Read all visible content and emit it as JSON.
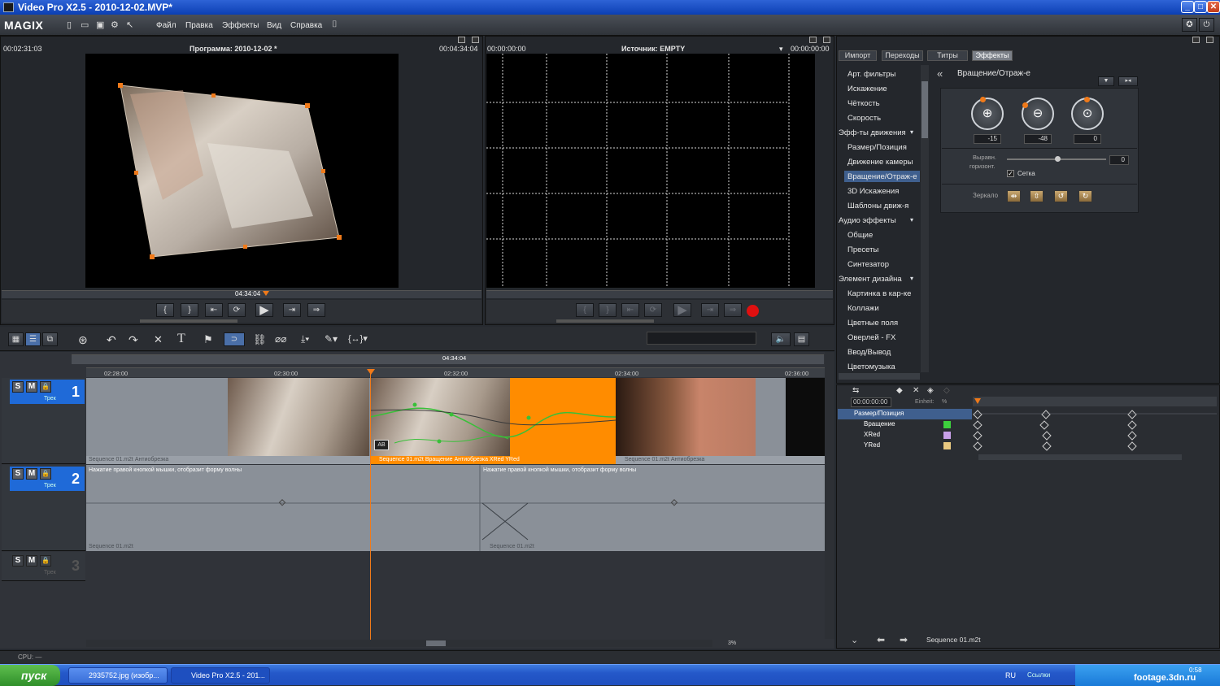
{
  "window": {
    "title": "Video Pro X2.5 - 2010-12-02.MVP*"
  },
  "menubar": {
    "logo": "MAGIX",
    "items": [
      "Файл",
      "Правка",
      "Эффекты",
      "Вид",
      "Справка"
    ]
  },
  "program_monitor": {
    "left_time": "00:02:31:03",
    "title": "Программа: 2010-12-02 *",
    "right_time": "00:04:34:04",
    "playhead_time": "04:34:04"
  },
  "source_monitor": {
    "left_time": "00:00:00:00",
    "title": "Источник: EMPTY",
    "right_time": "00:00:00:00"
  },
  "media_pool": {
    "tabs": [
      "Импорт",
      "Переходы",
      "Титры",
      "Эффекты"
    ],
    "active_tab": "Эффекты",
    "effects_list": [
      {
        "label": "Арт. фильтры",
        "type": "item"
      },
      {
        "label": "Искажение",
        "type": "item"
      },
      {
        "label": "Чёткость",
        "type": "item"
      },
      {
        "label": "Скорость",
        "type": "item"
      },
      {
        "label": "Эфф-ты движения",
        "type": "category"
      },
      {
        "label": "Размер/Позиция",
        "type": "item"
      },
      {
        "label": "Движение камеры",
        "type": "item"
      },
      {
        "label": "Вращение/Отраж-е",
        "type": "item",
        "selected": true
      },
      {
        "label": "3D Искажения",
        "type": "item"
      },
      {
        "label": "Шаблоны движ-я",
        "type": "item"
      },
      {
        "label": "Аудио эффекты",
        "type": "category"
      },
      {
        "label": "Общие",
        "type": "item"
      },
      {
        "label": "Пресеты",
        "type": "item"
      },
      {
        "label": "Синтезатор",
        "type": "item"
      },
      {
        "label": "Элемент дизайна",
        "type": "category"
      },
      {
        "label": "Картинка в кар-ке",
        "type": "item"
      },
      {
        "label": "Коллажи",
        "type": "item"
      },
      {
        "label": "Цветные поля",
        "type": "item"
      },
      {
        "label": "Оверлей - FX",
        "type": "item"
      },
      {
        "label": "Ввод/Вывод",
        "type": "item"
      },
      {
        "label": "Цветомузыка",
        "type": "item"
      }
    ],
    "effect_panel": {
      "title": "Вращение/Отраж-е",
      "knob_values": [
        "-15",
        "-48",
        "0"
      ],
      "align_label_1": "Выравн.",
      "align_label_2": "горизонт.",
      "align_value": "0",
      "grid_label": "Сетка",
      "grid_checked": true,
      "mirror_label": "Зеркало"
    }
  },
  "keyframes": {
    "time": "00:00:00:00",
    "unit_label": "Einheit:",
    "unit_value": "%",
    "rows": [
      "Размер/Позиция",
      "Вращение",
      "XRed",
      "YRed"
    ],
    "row_colors": [
      "#000000",
      "#3dd13d",
      "#c8a0e8",
      "#e8c880"
    ]
  },
  "timeline": {
    "top_time": "04:34:04",
    "ruler_labels": [
      "02:28:00",
      "02:30:00",
      "02:32:00",
      "02:34:00",
      "02:36:00"
    ],
    "tracks": [
      {
        "number": "1",
        "label": "Трек"
      },
      {
        "number": "2",
        "label": "Трек"
      },
      {
        "number": "3",
        "label": "Трек"
      }
    ],
    "clip_captions": {
      "v1a": "Sequence 01.m2t   Антиобрезка",
      "v1b": "Sequence 01.m2t   Вращение   Антиобрезка   XRed   YRed",
      "v1c": "Sequence 01.m2t   Антиобрезка",
      "a1_hint": "Нажатие правой кнопкой мышки, отобразит форму волны",
      "a2_hint": "Нажатие правой кнопкой мышки, отобразит форму волны",
      "a1_cap": "Sequence 01.m2t",
      "a2_cap": "Sequence 01.m2t"
    },
    "zoom": "3%"
  },
  "bottom_bar": {
    "cpu": "CPU: —",
    "sequence": "Sequence 01.m2t"
  },
  "taskbar": {
    "start": "пуск",
    "items": [
      "2935752.jpg (изобр...",
      "Video Pro X2.5 - 201..."
    ],
    "lang": "RU",
    "links": "Ссылки",
    "clock": "0:58",
    "watermark": "footage.3dn.ru"
  }
}
